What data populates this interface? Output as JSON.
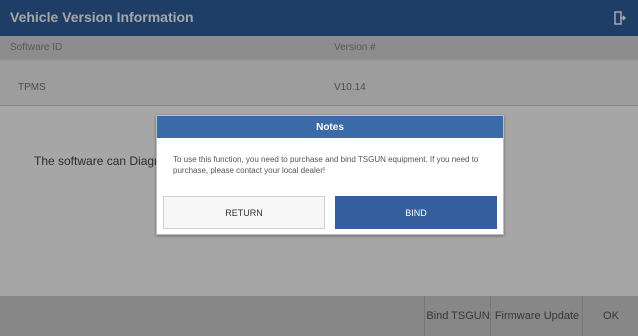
{
  "window": {
    "title": "Vehicle Version Information",
    "exit_icon": "exit-door-icon"
  },
  "table": {
    "headers": [
      "Software ID",
      "Version #"
    ],
    "rows": [
      {
        "software": "TPMS",
        "version": "V10.14"
      }
    ]
  },
  "description": "The software can Diagno",
  "bottom_bar": {
    "bind_tsgun": "Bind TSGUN",
    "firmware_update": "Firmware Update",
    "ok": "OK"
  },
  "dialog": {
    "title": "Notes",
    "message": "To use this function, you need to purchase and bind TSGUN equipment. If you need to purchase, please contact your local dealer!",
    "return_label": "RETURN",
    "bind_label": "BIND"
  },
  "colors": {
    "titlebar": "#2f5f9f",
    "dialog_header": "#3a6aa7",
    "bind_button": "#345f9c"
  }
}
